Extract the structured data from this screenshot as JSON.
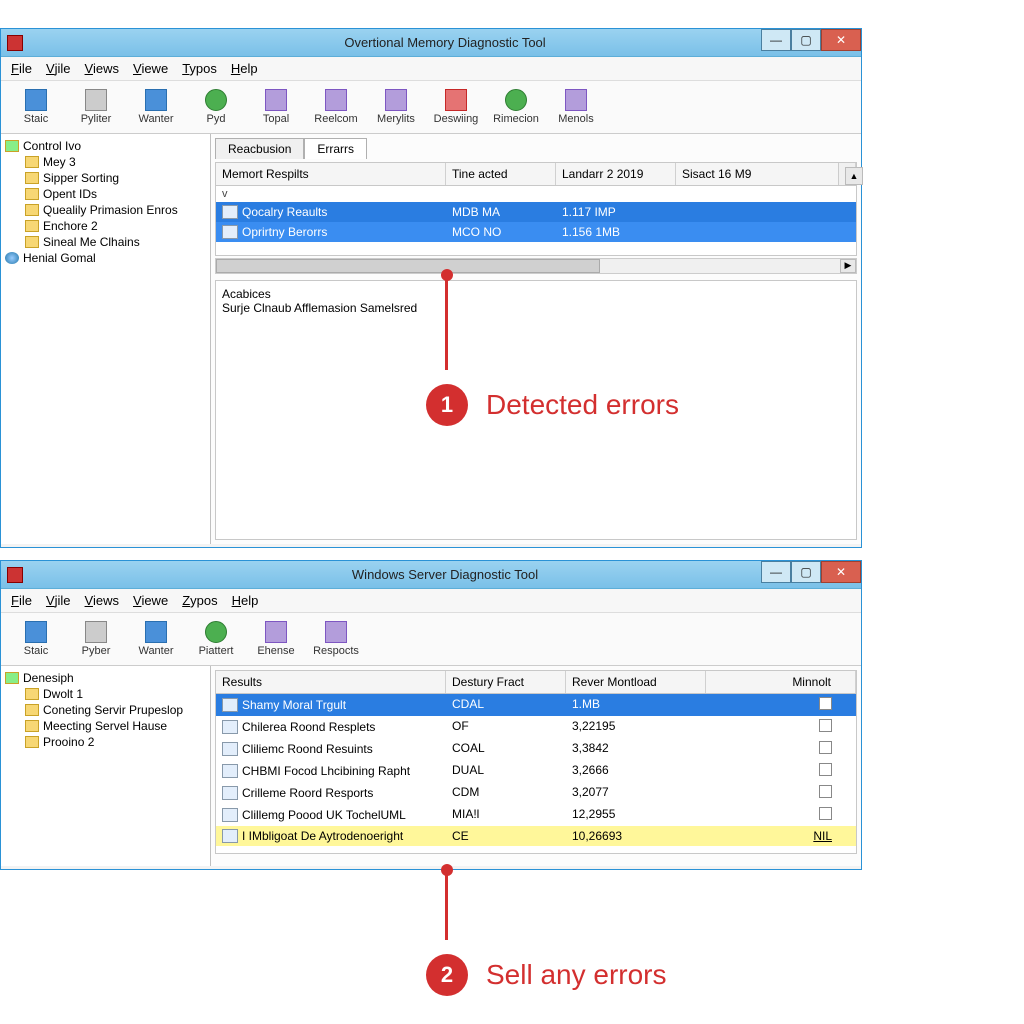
{
  "win1": {
    "title": "Overtional Memory Diagnostic Tool",
    "menu": [
      "File",
      "Vjile",
      "Views",
      "Viewe",
      "Typos",
      "Help"
    ],
    "menu_underline": [
      0,
      0,
      -1,
      -1,
      0,
      0
    ],
    "toolbar": [
      {
        "label": "Staic",
        "cls": "tool-blue"
      },
      {
        "label": "Pyliter",
        "cls": "tool-gray"
      },
      {
        "label": "Wanter",
        "cls": "tool-blue"
      },
      {
        "label": "Pyd",
        "cls": "tool-green"
      },
      {
        "label": "Topal",
        "cls": "tool-purple"
      },
      {
        "label": "Reelcom",
        "cls": "tool-purple"
      },
      {
        "label": "Merylits",
        "cls": "tool-purple"
      },
      {
        "label": "Deswiing",
        "cls": "tool-red"
      },
      {
        "label": "Rimecion",
        "cls": "tool-green"
      },
      {
        "label": "Menols",
        "cls": "tool-purple"
      }
    ],
    "tree_root": "Control Ivo",
    "tree_items": [
      "Mey 3",
      "Sipper Sorting",
      "Opent IDs",
      "Quealily Primasion Enros",
      "Enchore 2",
      "Sineal Me Clhains"
    ],
    "tree_globe": "Henial Gomal",
    "tabs": [
      "Reacbusion",
      "Errarrs"
    ],
    "cols": [
      "Memort Respilts",
      "Tine acted",
      "Landarr 2 2019",
      "Sisact 16 M9"
    ],
    "rows": [
      {
        "subhdr": "v",
        "cols": [
          "",
          "",
          "",
          ""
        ]
      },
      {
        "sel": true,
        "cols": [
          "Qocalry Reaults",
          "MDB MA",
          "1.117 IMP",
          ""
        ]
      },
      {
        "sel2": true,
        "cols": [
          "Oprirtny Berorrs",
          "MCO NO",
          "1.156 1MB",
          ""
        ]
      }
    ],
    "details_t1": "Acabices",
    "details_t2": "Surje Clnaub Afflemasion Samelsred"
  },
  "win2": {
    "title": "Windows Server Diagnostic Tool",
    "menu": [
      "File",
      "Vjile",
      "Views",
      "Viewe",
      "Zypos",
      "Help"
    ],
    "toolbar": [
      {
        "label": "Staic",
        "cls": "tool-blue"
      },
      {
        "label": "Pyber",
        "cls": "tool-gray"
      },
      {
        "label": "Wanter",
        "cls": "tool-blue"
      },
      {
        "label": "Piattert",
        "cls": "tool-green"
      },
      {
        "label": "Ehense",
        "cls": "tool-purple"
      },
      {
        "label": "Respocts",
        "cls": "tool-purple"
      }
    ],
    "tree_root": "Denesiph",
    "tree_items": [
      "Dwolt 1",
      "Coneting Servir Prupeslop",
      "Meecting Servel Hause",
      "Prooino 2"
    ],
    "cols": [
      "Results",
      "Destury Fract",
      "Rever Montload",
      "Minnolt"
    ],
    "rows": [
      {
        "sel": true,
        "cols": [
          "Shamy Moral Trgult",
          "CDAL",
          "1.MB",
          ""
        ]
      },
      {
        "cols": [
          "Chilerea Roond Resplets",
          "OF",
          "3,22195",
          ""
        ]
      },
      {
        "cols": [
          "Cliliemc Roond Resuints",
          "COAL",
          "3,3842",
          ""
        ]
      },
      {
        "cols": [
          "CHBMI Focod Lhcibining Rapht",
          "DUAL",
          "3,2666",
          ""
        ]
      },
      {
        "cols": [
          "Crilleme Roord Resports",
          "CDM",
          "3,2077",
          ""
        ]
      },
      {
        "cols": [
          "Clillemg Poood UK TochelUML",
          "MIA!l",
          "12,2955",
          ""
        ]
      },
      {
        "hi": true,
        "cols": [
          "I IMbligoat De Aytrodenoeright",
          "CE",
          "10,26693",
          "NIL"
        ]
      }
    ]
  },
  "callout1": "Detected errors",
  "callout1_num": "1",
  "callout2": "Sell any errors",
  "callout2_num": "2"
}
